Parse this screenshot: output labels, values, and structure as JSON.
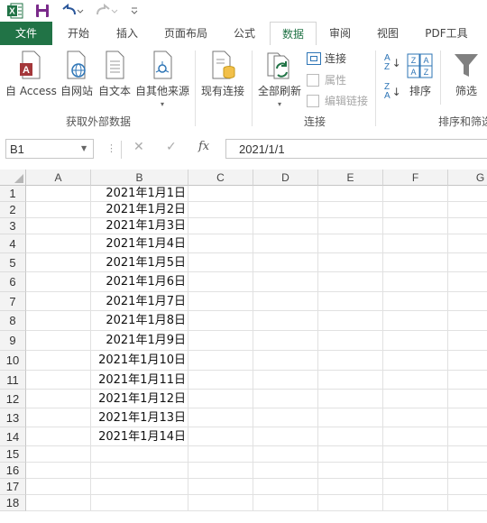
{
  "quick_access": {
    "excel_logo": "X",
    "save": "save-icon",
    "undo": "undo-icon",
    "redo": "redo-icon",
    "customize": "customize-qat-icon"
  },
  "tabs": [
    {
      "label": "文件",
      "kind": "file"
    },
    {
      "label": "开始",
      "kind": "normal"
    },
    {
      "label": "插入",
      "kind": "normal"
    },
    {
      "label": "页面布局",
      "kind": "normal"
    },
    {
      "label": "公式",
      "kind": "normal"
    },
    {
      "label": "数据",
      "kind": "active"
    },
    {
      "label": "审阅",
      "kind": "normal"
    },
    {
      "label": "视图",
      "kind": "normal"
    },
    {
      "label": "PDF工具",
      "kind": "normal"
    }
  ],
  "ribbon": {
    "get_external": {
      "access": "自 Access",
      "web": "自网站",
      "text": "自文本",
      "other": "自其他来源",
      "group_label": "获取外部数据"
    },
    "existing_conn": "现有连接",
    "connections": {
      "refresh_all": "全部刷新",
      "connections": "连接",
      "properties": "属性",
      "edit_links": "编辑链接",
      "group_label": "连接"
    },
    "sort_filter": {
      "sort": "排序",
      "filter": "筛选",
      "group_label": "排序和筛选"
    }
  },
  "formula_bar": {
    "name_box": "B1",
    "cancel": "✕",
    "enter": "✓",
    "fx": "fx",
    "content": "2021/1/1"
  },
  "columns": [
    "A",
    "B",
    "C",
    "D",
    "E",
    "F",
    "G"
  ],
  "rows": [
    "1",
    "2",
    "3",
    "4",
    "5",
    "6",
    "7",
    "8",
    "9",
    "10",
    "11",
    "12",
    "13",
    "14",
    "15",
    "16",
    "17",
    "18"
  ],
  "cells_B": [
    "2021年1月1日",
    "2021年1月2日",
    "2021年1月3日",
    "2021年1月4日",
    "2021年1月5日",
    "2021年1月6日",
    "2021年1月7日",
    "2021年1月8日",
    "2021年1月9日",
    "2021年1月10日",
    "2021年1月11日",
    "2021年1月12日",
    "2021年1月13日",
    "2021年1月14日",
    "",
    "",
    "",
    ""
  ],
  "colors": {
    "accent": "#217346",
    "header_bg": "#f3f3f3",
    "gridline": "#e1e1e1"
  }
}
